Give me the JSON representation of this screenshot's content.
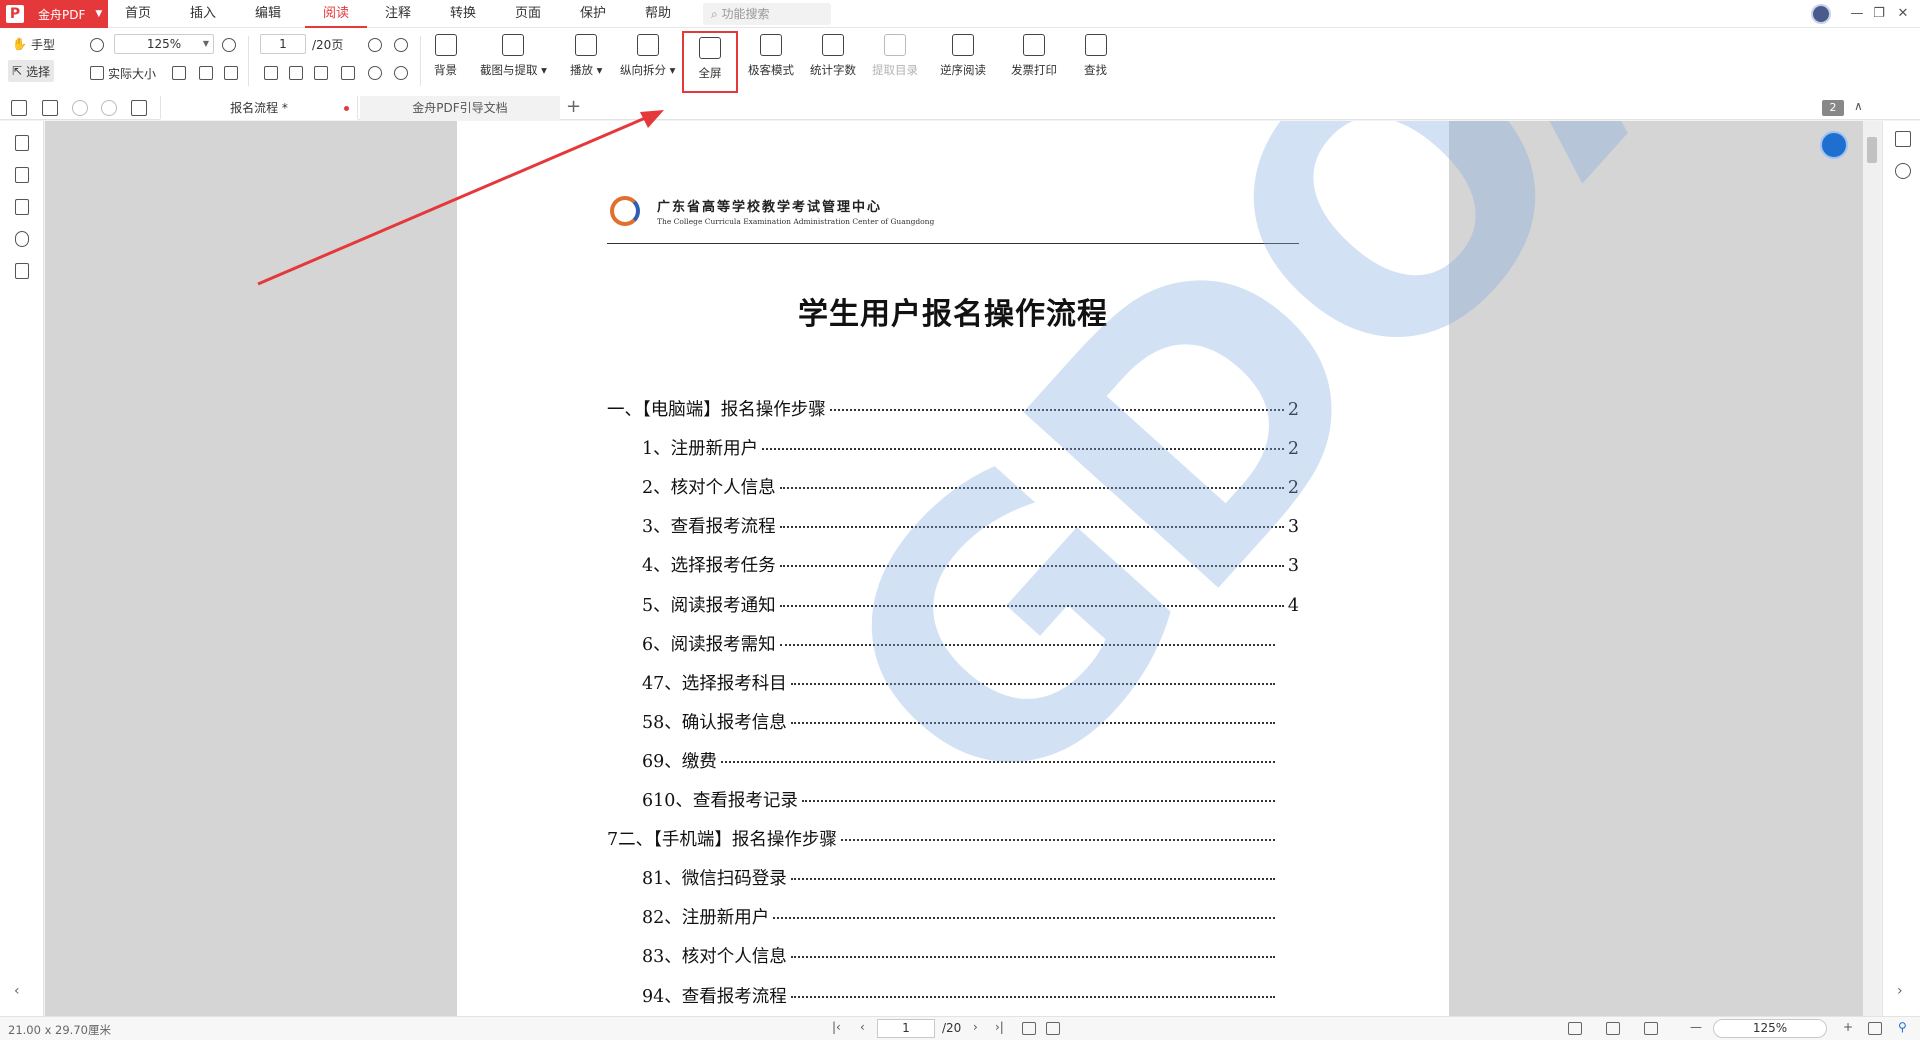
{
  "app": {
    "name": "金舟PDF",
    "accent": "#e5383b"
  },
  "menu": {
    "items": [
      "首页",
      "插入",
      "编辑",
      "阅读",
      "注释",
      "转换",
      "页面",
      "保护",
      "帮助"
    ],
    "active": "阅读",
    "search_placeholder": "功能搜索"
  },
  "ribbon": {
    "hand": "手型",
    "select": "选择",
    "zoom": "125%",
    "actual_size": "实际大小",
    "page_current": "1",
    "page_total": "/20页",
    "tools": [
      {
        "label": "背景",
        "icon": "background-icon",
        "enabled": true
      },
      {
        "label": "截图与提取 ▾",
        "icon": "screenshot-icon",
        "enabled": true
      },
      {
        "label": "播放 ▾",
        "icon": "play-icon",
        "enabled": true
      },
      {
        "label": "纵向拆分 ▾",
        "icon": "split-icon",
        "enabled": true
      },
      {
        "label": "全屏",
        "icon": "fullscreen-icon",
        "enabled": true,
        "highlighted": true
      },
      {
        "label": "极客模式",
        "icon": "geek-mode-icon",
        "enabled": true
      },
      {
        "label": "统计字数",
        "icon": "word-count-icon",
        "enabled": true
      },
      {
        "label": "提取目录",
        "icon": "extract-toc-icon",
        "enabled": false
      },
      {
        "label": "逆序阅读",
        "icon": "reverse-read-icon",
        "enabled": true
      },
      {
        "label": "发票打印",
        "icon": "invoice-print-icon",
        "enabled": true
      },
      {
        "label": "查找",
        "icon": "find-icon",
        "enabled": true
      }
    ]
  },
  "tabs": [
    {
      "label": "报名流程 *",
      "active": true,
      "modified": true
    },
    {
      "label": "金舟PDF引导文档",
      "active": false,
      "modified": false
    }
  ],
  "page_badge": "2",
  "document": {
    "org_cn": "广东省高等学校教学考试管理中心",
    "org_en": "The College Curricula Examination Administration Center of Guangdong",
    "title": "学生用户报名操作流程",
    "watermark": "GDOA",
    "toc": [
      {
        "text": "一、【电脑端】报名操作步骤",
        "page": "2",
        "level": 0
      },
      {
        "text": "1、注册新用户",
        "page": "2",
        "level": 1
      },
      {
        "text": "2、核对个人信息",
        "page": "2",
        "level": 1
      },
      {
        "text": "3、查看报考流程",
        "page": "3",
        "level": 1
      },
      {
        "text": "4、选择报考任务",
        "page": "3",
        "level": 1
      },
      {
        "text": "5、阅读报考通知",
        "page": "4",
        "level": 1
      },
      {
        "text": "6、阅读报考需知",
        "page": "",
        "level": 1
      },
      {
        "text": "47、选择报考科目",
        "page": "",
        "level": 1
      },
      {
        "text": "58、确认报考信息",
        "page": "",
        "level": 1
      },
      {
        "text": "69、缴费",
        "page": "",
        "level": 1
      },
      {
        "text": "610、查看报考记录",
        "page": "",
        "level": 1
      },
      {
        "text": "7二、【手机端】报名操作步骤",
        "page": "",
        "level": 0
      },
      {
        "text": "81、微信扫码登录",
        "page": "",
        "level": 1
      },
      {
        "text": "82、注册新用户",
        "page": "",
        "level": 1
      },
      {
        "text": "83、核对个人信息",
        "page": "",
        "level": 1
      },
      {
        "text": "94、查看报考流程",
        "page": "",
        "level": 1
      }
    ]
  },
  "statusbar": {
    "dimensions": "21.00 x 29.70厘米",
    "page_current": "1",
    "page_total": "/20",
    "zoom": "125%"
  }
}
